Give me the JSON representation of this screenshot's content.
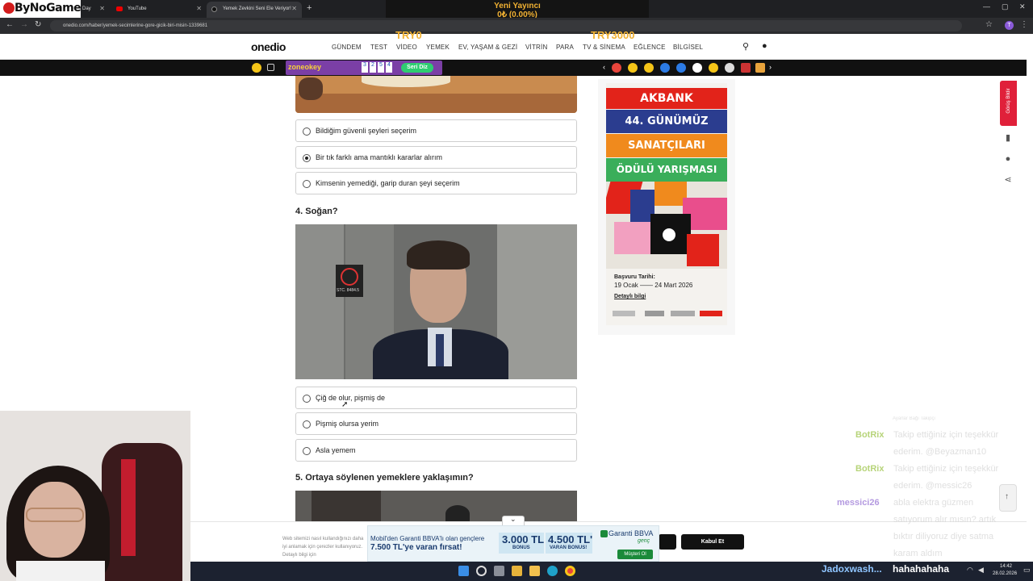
{
  "stream": {
    "logo": "ByNoGame",
    "alert_title": "Yeni Yayıncı",
    "alert_amount": "0₺ (0.00%)",
    "goal_start": "TRY0",
    "goal_end": "TRY3000",
    "bottom_user": "Jadoxwash...",
    "bottom_msg": "hahahahaha"
  },
  "browser": {
    "tabs": [
      "Day",
      "YouTube",
      "Yemek Zevkini Seni Ele Veriyor!"
    ],
    "url": "onedio.com/haber/yemek-secimlerine-gore-gicik-biri-misin-1339681",
    "profile_initial": "T"
  },
  "site": {
    "logo": "onedio",
    "nav": [
      "GÜNDEM",
      "TEST",
      "VİDEO",
      "YEMEK",
      "EV, YAŞAM & GEZİ",
      "VİTRİN",
      "PARA",
      "TV & SİNEMA",
      "EĞLENCE",
      "BİLGİSEL"
    ],
    "zone_logo": "zoneokey",
    "seri_diz": "Seri Diz",
    "tiles": [
      "3",
      "2",
      "5",
      "4"
    ]
  },
  "quiz": {
    "q3_options": [
      {
        "label": "Bildiğim güvenli şeyleri seçerim",
        "selected": false
      },
      {
        "label": "Bir tık farklı ama mantıklı kararlar alırım",
        "selected": true
      },
      {
        "label": "Kimsenin yemediği, garip duran şeyi seçerim",
        "selected": false
      }
    ],
    "q4_title": "4. Soğan?",
    "q4_image_sign": "STC. 8484.5",
    "q4_options": [
      {
        "label": "Çiğ de olur, pişmiş de",
        "selected": false
      },
      {
        "label": "Pişmiş olursa yerim",
        "selected": false
      },
      {
        "label": "Asla yemem",
        "selected": false
      }
    ],
    "q5_title": "5. Ortaya söylenen yemeklere yaklaşımın?"
  },
  "ad": {
    "bands": [
      "AKBANK",
      "44. GÜNÜMÜZ",
      "SANATÇILARI",
      "ÖDÜLÜ YARIŞMASI"
    ],
    "band_colors": [
      "#e2231a",
      "#2b3d8f",
      "#f08a1d",
      "#3aae5a"
    ],
    "date_label": "Başvuru Tarihi:",
    "dates": "19 Ocak —— 24 Mart 2026",
    "details": "Detaylı bilgi"
  },
  "rail": {
    "report": "Görüş Bildir"
  },
  "cookie": {
    "text": "Web sitemizi nasıl kullandığınızı daha iyi anlamak için çerezler kullanıyoruz. Detaylı bilgi için",
    "accept": "Kabul Et",
    "banner_text": "Mobil'den Garanti BBVA'lı olan gençlere",
    "banner_bold": "7.500 TL'ye varan fırsat!",
    "bonus1": "3.000 TL",
    "bonus1_sub": "BONUS",
    "bonus2": "4.500 TL'",
    "bonus2_sub": "VARAN BONUS!",
    "brand": "Garanti BBVA",
    "brand_sub": "genç",
    "cta": "Müşteri Ol"
  },
  "chat": {
    "header": "Ayarlar Bağı Takipçi",
    "lines": [
      {
        "user": "BotRix",
        "msg": "Takip ettiğiniz için teşekkür"
      },
      {
        "user": "",
        "msg": "ederim. @Beyazman10"
      },
      {
        "user": "BotRix",
        "msg": "Takip ettiğiniz için teşekkür"
      },
      {
        "user": "",
        "msg": "ederim. @messic26"
      },
      {
        "user": "messici26",
        "msg": "abla elektra güzmen"
      },
      {
        "user": "",
        "msg": "satıyorum alır mısın? artık"
      },
      {
        "user": "",
        "msg": "bıktır diliyoruz diye satma"
      },
      {
        "user": "",
        "msg": "karam aldım"
      }
    ]
  },
  "taskbar": {
    "time": "14:42",
    "date": "28.02.2026"
  }
}
